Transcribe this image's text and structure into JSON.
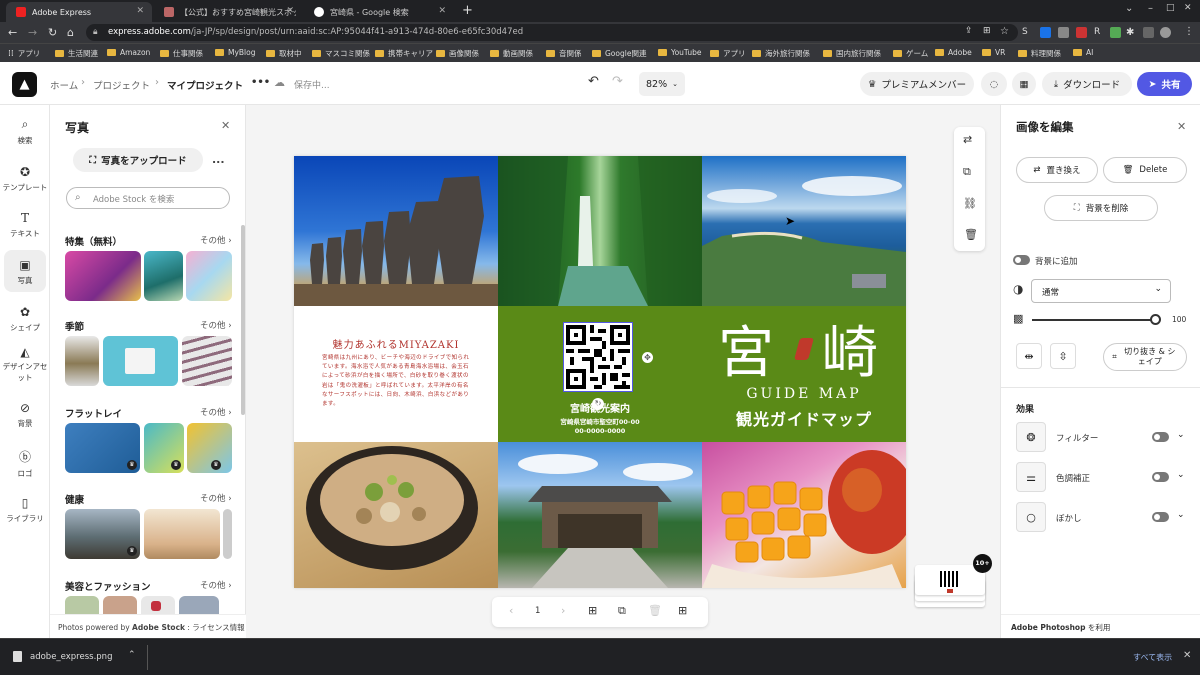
{
  "browser": {
    "tabs": [
      {
        "title": "Adobe Express",
        "active": true
      },
      {
        "title": "【公式】おすすめ宮崎観光スポット／...",
        "active": false
      },
      {
        "title": "宮崎県 - Google 検索",
        "active": false
      }
    ],
    "new_tab": "+",
    "url_host": "express.adobe.com",
    "url_path": "/ja-JP/sp/design/post/urn:aaid:sc:AP:95044f41-a913-474d-80e6-e65fc30d47ed",
    "bookmarks": [
      "アプリ",
      "生活関連",
      "Amazon",
      "仕事関係",
      "MyBlog",
      "取材中",
      "マスコミ関係",
      "携帯キャリア",
      "画像関係",
      "動画関係",
      "音関係",
      "Google関連",
      "YouTube",
      "アプリ",
      "海外旅行関係",
      "国内旅行関係",
      "ゲーム",
      "Adobe",
      "VR",
      "料理関係",
      "AI"
    ],
    "window_controls": [
      "–",
      "□",
      "✕"
    ]
  },
  "header": {
    "home": "ホーム",
    "project": "プロジェクト",
    "my_project": "マイプロジェクト",
    "more": "•••",
    "saving": "保存中...",
    "zoom": "82%",
    "premium": "プレミアムメンバー",
    "download": "ダウンロード",
    "share": "共有"
  },
  "rail": [
    {
      "label": "検索",
      "icon": "search-icon"
    },
    {
      "label": "テンプレート",
      "icon": "template-icon"
    },
    {
      "label": "テキスト",
      "icon": "text-icon"
    },
    {
      "label": "写真",
      "icon": "photo-icon"
    },
    {
      "label": "シェイプ",
      "icon": "shape-icon"
    },
    {
      "label": "デザインアセット",
      "icon": "design-asset-icon"
    },
    {
      "label": "背景",
      "icon": "background-icon"
    },
    {
      "label": "ロゴ",
      "icon": "logo-icon"
    },
    {
      "label": "ライブラリ",
      "icon": "library-icon"
    }
  ],
  "panel": {
    "title": "写真",
    "upload": "写真をアップロード",
    "more": "...",
    "search_placeholder": "Adobe Stock を検索",
    "sections": [
      {
        "title": "特集（無料）",
        "more": "その他 ›"
      },
      {
        "title": "季節",
        "more": "その他 ›"
      },
      {
        "title": "フラットレイ",
        "more": "その他 ›"
      },
      {
        "title": "健康",
        "more": "その他 ›"
      },
      {
        "title": "美容とファッション",
        "more": "その他 ›"
      }
    ],
    "footer_prefix": "Photos powered by ",
    "footer_brand": "Adobe Stock",
    "footer_suffix": " : ライセンス情報"
  },
  "design": {
    "intro_title": "魅力あふれるMIYAZAKI",
    "intro_body": "宮崎県は九州にあり、ビーチや海辺のドライブで知られています。海水浴で人気がある青島海水浴場は、会玉石によって砂浜が白を描く場所で、白砂を取り巻く渡状の岩は「鬼の洗濯板」と呼ばれています。太平洋岸の有名なサーフスポットには、日向、木崎浜、白浜などがあります。",
    "qr_label": "宮崎観光案内",
    "address": "宮崎県宮崎市聖空町00-00",
    "phone": "00-0000-0000",
    "big_title_1": "宮",
    "big_title_2": "崎",
    "guide_map": "GUIDE MAP",
    "guide_jp": "観光ガイドマップ"
  },
  "pager": {
    "page": "1"
  },
  "badge": "10+",
  "right": {
    "title": "画像を編集",
    "replace": "置き換え",
    "delete": "Delete",
    "remove_bg": "背景を削除",
    "add_to_bg": "背景に追加",
    "blend": "通常",
    "opacity": "100",
    "crop": "切り抜き & シェイプ",
    "effects": "効果",
    "filter": "フィルター",
    "adjust": "色調補正",
    "blur": "ぼかし",
    "photoshop_brand": "Adobe Photoshop",
    "photoshop_suffix": " を利用"
  },
  "downloads": {
    "file": "adobe_express.png",
    "show_all": "すべて表示"
  },
  "colors": {
    "accent": "#5258e4",
    "green": "#5a8a17",
    "bg": "#f4f4f4"
  }
}
